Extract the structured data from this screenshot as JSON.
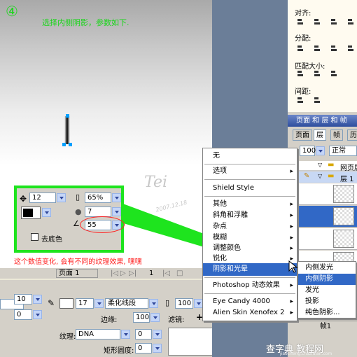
{
  "canvas": {
    "step_number": "④",
    "instruction": "选择内侧阴影，参数如下.",
    "signature": "Tei",
    "signature_date": "2007.12.18",
    "note": "这个数值变化, 会有不同的纹理效果, 嘿嘿"
  },
  "effect_panel": {
    "distance": "12",
    "opacity": "65%",
    "softness": "7",
    "angle": "55",
    "knockout_label": "去底色",
    "color": "#000000"
  },
  "status_bar": {
    "page_select": "页面 1",
    "page_count": "1"
  },
  "properties": {
    "stroke_size": "17",
    "stroke_type": "柔化线段",
    "stroke_opacity": "100",
    "edge_label": "边缘:",
    "edge_value": "100",
    "texture_label": "纹理:",
    "texture_value": "DNA",
    "texture_amount": "0",
    "roundness_label": "矩形圆度:",
    "roundness_value": "0",
    "filters_label": "滤镜:",
    "left_value_1": "10",
    "left_value_2": "0"
  },
  "align_panel": {
    "title": "对齐:",
    "distribute": "分配:",
    "match_size": "匹配大小:",
    "spacing": "间距:"
  },
  "layers_panel": {
    "title": "页面 和 层 和 帧",
    "tabs": [
      "页面",
      "层",
      "帧",
      "历"
    ],
    "opacity": "100",
    "blend": "正常",
    "rows": [
      "网页层",
      "层 1"
    ],
    "frame_label": "帧1"
  },
  "context_menu": {
    "items": [
      "无",
      "选项",
      "Shield Style",
      "其他",
      "斜角和浮雕",
      "杂点",
      "模糊",
      "调整颜色",
      "锐化",
      "阴影和光晕",
      "Photoshop 动态效果",
      "Eye Candy 4000",
      "Alien Skin Xenofex 2"
    ]
  },
  "submenu": {
    "items": [
      "内侧发光",
      "内侧阴影",
      "发光",
      "投影",
      "纯色阴影..."
    ]
  },
  "watermark": {
    "text": "查字典 教程网",
    "url": "jiaocheng.chazidian.com"
  },
  "colors": {
    "accent_green": "#1ee41e",
    "note_red": "#ff2020",
    "menu_highlight": "#3168c6"
  }
}
